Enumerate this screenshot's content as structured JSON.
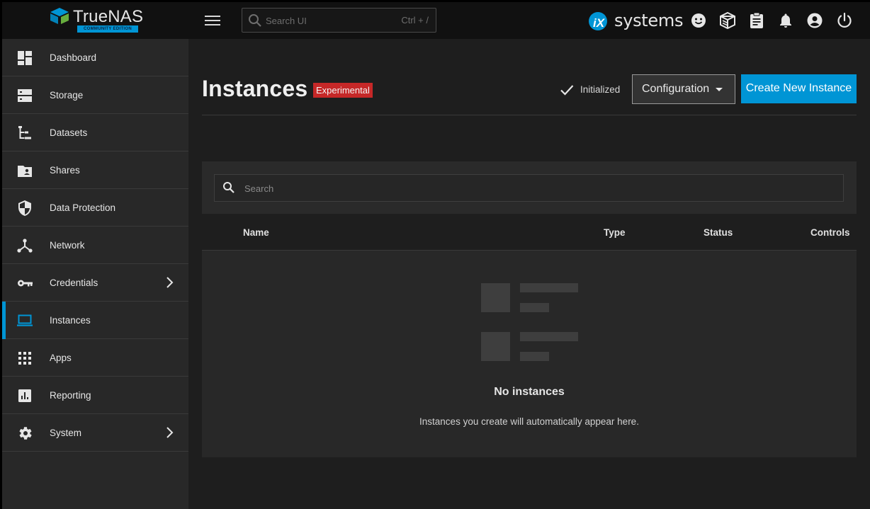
{
  "brand": {
    "name": "TrueNAS",
    "edition": "COMMUNITY EDITION",
    "vendor_logo_text": "systems",
    "vendor_logo_mark": "iX"
  },
  "search": {
    "placeholder": "Search UI",
    "shortcut": "Ctrl + /"
  },
  "topbar_icons": [
    "feedback-icon",
    "truecommand-icon",
    "jobs-icon",
    "notifications-icon",
    "account-icon",
    "power-icon"
  ],
  "sidebar": {
    "items": [
      {
        "label": "Dashboard",
        "icon": "dashboard-icon"
      },
      {
        "label": "Storage",
        "icon": "storage-icon"
      },
      {
        "label": "Datasets",
        "icon": "datasets-icon"
      },
      {
        "label": "Shares",
        "icon": "shares-icon"
      },
      {
        "label": "Data Protection",
        "icon": "shield-icon"
      },
      {
        "label": "Network",
        "icon": "network-icon"
      },
      {
        "label": "Credentials",
        "icon": "key-icon",
        "has_children": true
      },
      {
        "label": "Instances",
        "icon": "laptop-icon",
        "active": true
      },
      {
        "label": "Apps",
        "icon": "apps-grid-icon"
      },
      {
        "label": "Reporting",
        "icon": "chart-icon"
      },
      {
        "label": "System",
        "icon": "gear-icon",
        "has_children": true
      }
    ]
  },
  "page": {
    "title": "Instances",
    "badge": "Experimental",
    "status": "Initialized",
    "config_button": "Configuration",
    "create_button": "Create New Instance"
  },
  "table": {
    "search_placeholder": "Search",
    "columns": [
      "Name",
      "Type",
      "Status",
      "Controls"
    ],
    "rows": [],
    "empty_title": "No instances",
    "empty_message": "Instances you create will automatically appear here."
  },
  "colors": {
    "accent": "#0095d5",
    "badge": "#c62828",
    "sidebar_bg": "#282828",
    "main_bg": "#1e1e1e",
    "topbar_bg": "#111111"
  }
}
